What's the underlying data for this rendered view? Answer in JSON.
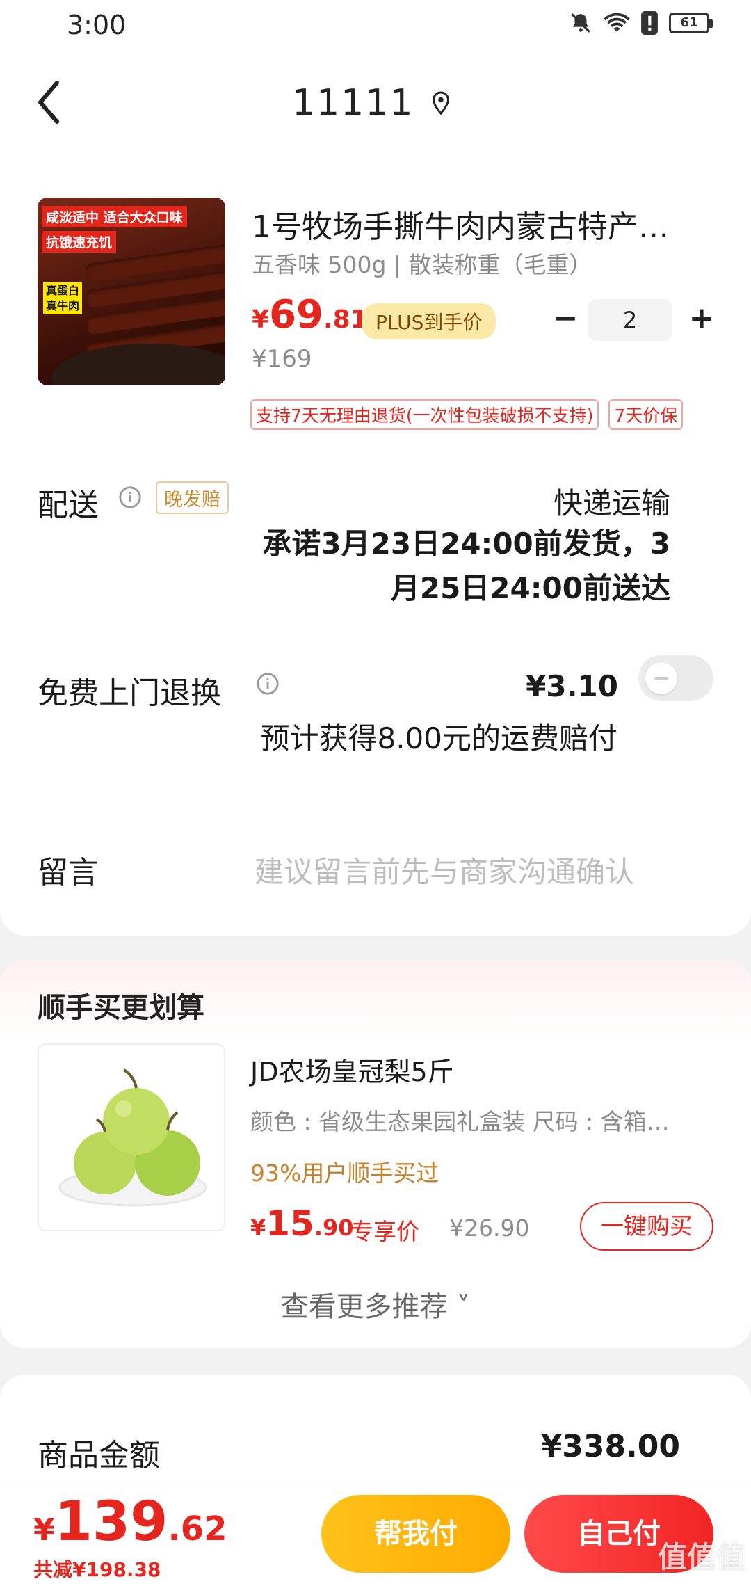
{
  "status_bar": {
    "time": "3:00",
    "battery": "61"
  },
  "header": {
    "title": "11111"
  },
  "product": {
    "title": "1号牧场手撕牛肉内蒙古特产…",
    "spec": "五香味 500g | 散装称重（毛重）",
    "price_symbol": "¥",
    "price_int": "69",
    "price_dec": ".81",
    "plus_label": "PLUS到手价",
    "orig_price": "¥169",
    "quantity": "2",
    "qty_minus": "−",
    "qty_plus": "+",
    "image_labels": [
      "咸淡适中 适合大众口味",
      "抗饿速充饥",
      "真蛋白",
      "真牛肉"
    ],
    "tags": [
      "支持7天无理由退货(一次性包装破损不支持)",
      "7天价保"
    ]
  },
  "delivery": {
    "label": "配送",
    "badge": "晚发赔",
    "method": "快递运输",
    "promise": "承诺3月23日24:00前发货，3月25日24:00前送达"
  },
  "free_return": {
    "label": "免费上门退换",
    "price": "¥3.10",
    "note": "预计获得8.00元的运费赔付",
    "enabled": false
  },
  "message": {
    "label": "留言",
    "placeholder": "建议留言前先与商家沟通确认"
  },
  "recommend": {
    "title": "顺手买更划算",
    "name": "JD农场皇冠梨5斤",
    "spec": "颜色 : 省级生态果园礼盒装    尺码 : 含箱…",
    "social": "93%用户顺手买过",
    "price_symbol": "¥",
    "price_int": "15",
    "price_dec": ".90",
    "exclusive": "专享价",
    "orig_price": "¥26.90",
    "buy_label": "一键购买",
    "more": "查看更多推荐 ˅"
  },
  "summary": {
    "label": "商品金额",
    "value": "¥338.00"
  },
  "bottom": {
    "price_symbol": "¥",
    "price_int": "139",
    "price_dec": ".62",
    "saved": "共减¥198.38",
    "help_pay": "帮我付",
    "self_pay": "自己付"
  },
  "watermark": "值值值",
  "colors": {
    "accent_red": "#e4261f",
    "plus_bg": "#fce9a8",
    "help_pay": "#ffb400",
    "self_pay": "#f22424"
  }
}
